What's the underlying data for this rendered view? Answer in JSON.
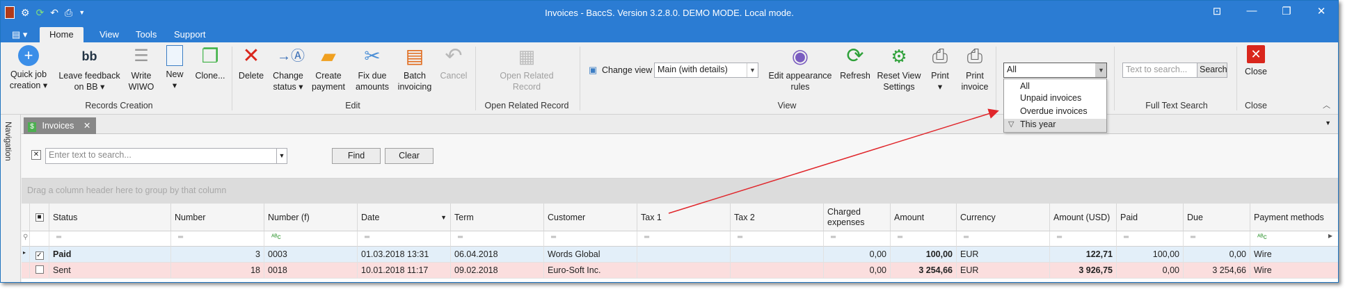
{
  "window": {
    "title": "Invoices - BaccS. Version 3.2.8.0. DEMO MODE. Local mode.",
    "accent": "#2b7cd3"
  },
  "quick_access": [
    "app-icon",
    "settings-icon",
    "refresh-icon",
    "undo-icon",
    "print-icon",
    "customize-arrow-icon"
  ],
  "menu": {
    "tabs": [
      "Home",
      "View",
      "Tools",
      "Support"
    ],
    "active": "Home"
  },
  "ribbon": {
    "records_creation": {
      "label": "Records Creation",
      "buttons": {
        "quick_job": "Quick job creation",
        "leave_feedback": "Leave feedback on BB",
        "write_wiwo": "Write WIWO",
        "new": "New",
        "clone": "Clone..."
      }
    },
    "edit": {
      "label": "Edit",
      "buttons": {
        "delete": "Delete",
        "change_status": "Change status",
        "create_payment": "Create payment",
        "fix_due": "Fix due amounts",
        "batch_invoicing": "Batch invoicing",
        "cancel": "Cancel"
      }
    },
    "open_related": {
      "label": "Open Related Record",
      "button": "Open Related Record"
    },
    "view": {
      "label": "View",
      "change_view_label": "Change view",
      "change_view_value": "Main (with details)",
      "buttons": {
        "edit_appearance": "Edit appearance rules",
        "refresh": "Refresh",
        "reset_view": "Reset View Settings",
        "print": "Print",
        "print_invoice": "Print invoice"
      }
    },
    "filter": {
      "value": "All",
      "options": [
        "All",
        "Unpaid invoices",
        "Overdue invoices",
        "This year"
      ],
      "highlighted": "This year"
    },
    "full_text_search": {
      "label": "Full Text Search",
      "placeholder": "Text to search...",
      "button": "Search"
    },
    "close": {
      "label": "Close",
      "button": "Close"
    }
  },
  "navigation_label": "Navigation",
  "doc_tab": {
    "label": "Invoices"
  },
  "search_panel": {
    "placeholder": "Enter text to search...",
    "find": "Find",
    "clear": "Clear"
  },
  "group_panel_hint": "Drag a column header here to group by that column",
  "grid": {
    "columns": [
      "Status",
      "Number",
      "Number (f)",
      "Date",
      "Term",
      "Customer",
      "Tax 1",
      "Tax 2",
      "Charged expenses",
      "Amount",
      "Currency",
      "Amount (USD)",
      "Paid",
      "Due",
      "Payment methods"
    ],
    "rows": [
      {
        "checked": true,
        "status": "Paid",
        "number": "3",
        "number_f": "0003",
        "date": "01.03.2018 13:31",
        "term": "06.04.2018",
        "customer": "Words Global",
        "tax1": "",
        "tax2": "",
        "charged": "0,00",
        "amount": "100,00",
        "currency": "EUR",
        "amount_usd": "122,71",
        "paid": "100,00",
        "due": "0,00",
        "payment": "Wire",
        "color": "#e3eff9"
      },
      {
        "checked": false,
        "status": "Sent",
        "number": "18",
        "number_f": "0018",
        "date": "10.01.2018 11:17",
        "term": "09.02.2018",
        "customer": "Euro-Soft Inc.",
        "tax1": "",
        "tax2": "",
        "charged": "0,00",
        "amount": "3 254,66",
        "currency": "EUR",
        "amount_usd": "3 926,75",
        "paid": "0,00",
        "due": "3 254,66",
        "payment": "Wire",
        "color": "#fbdede"
      }
    ]
  },
  "annotation_color": "#e0262b"
}
